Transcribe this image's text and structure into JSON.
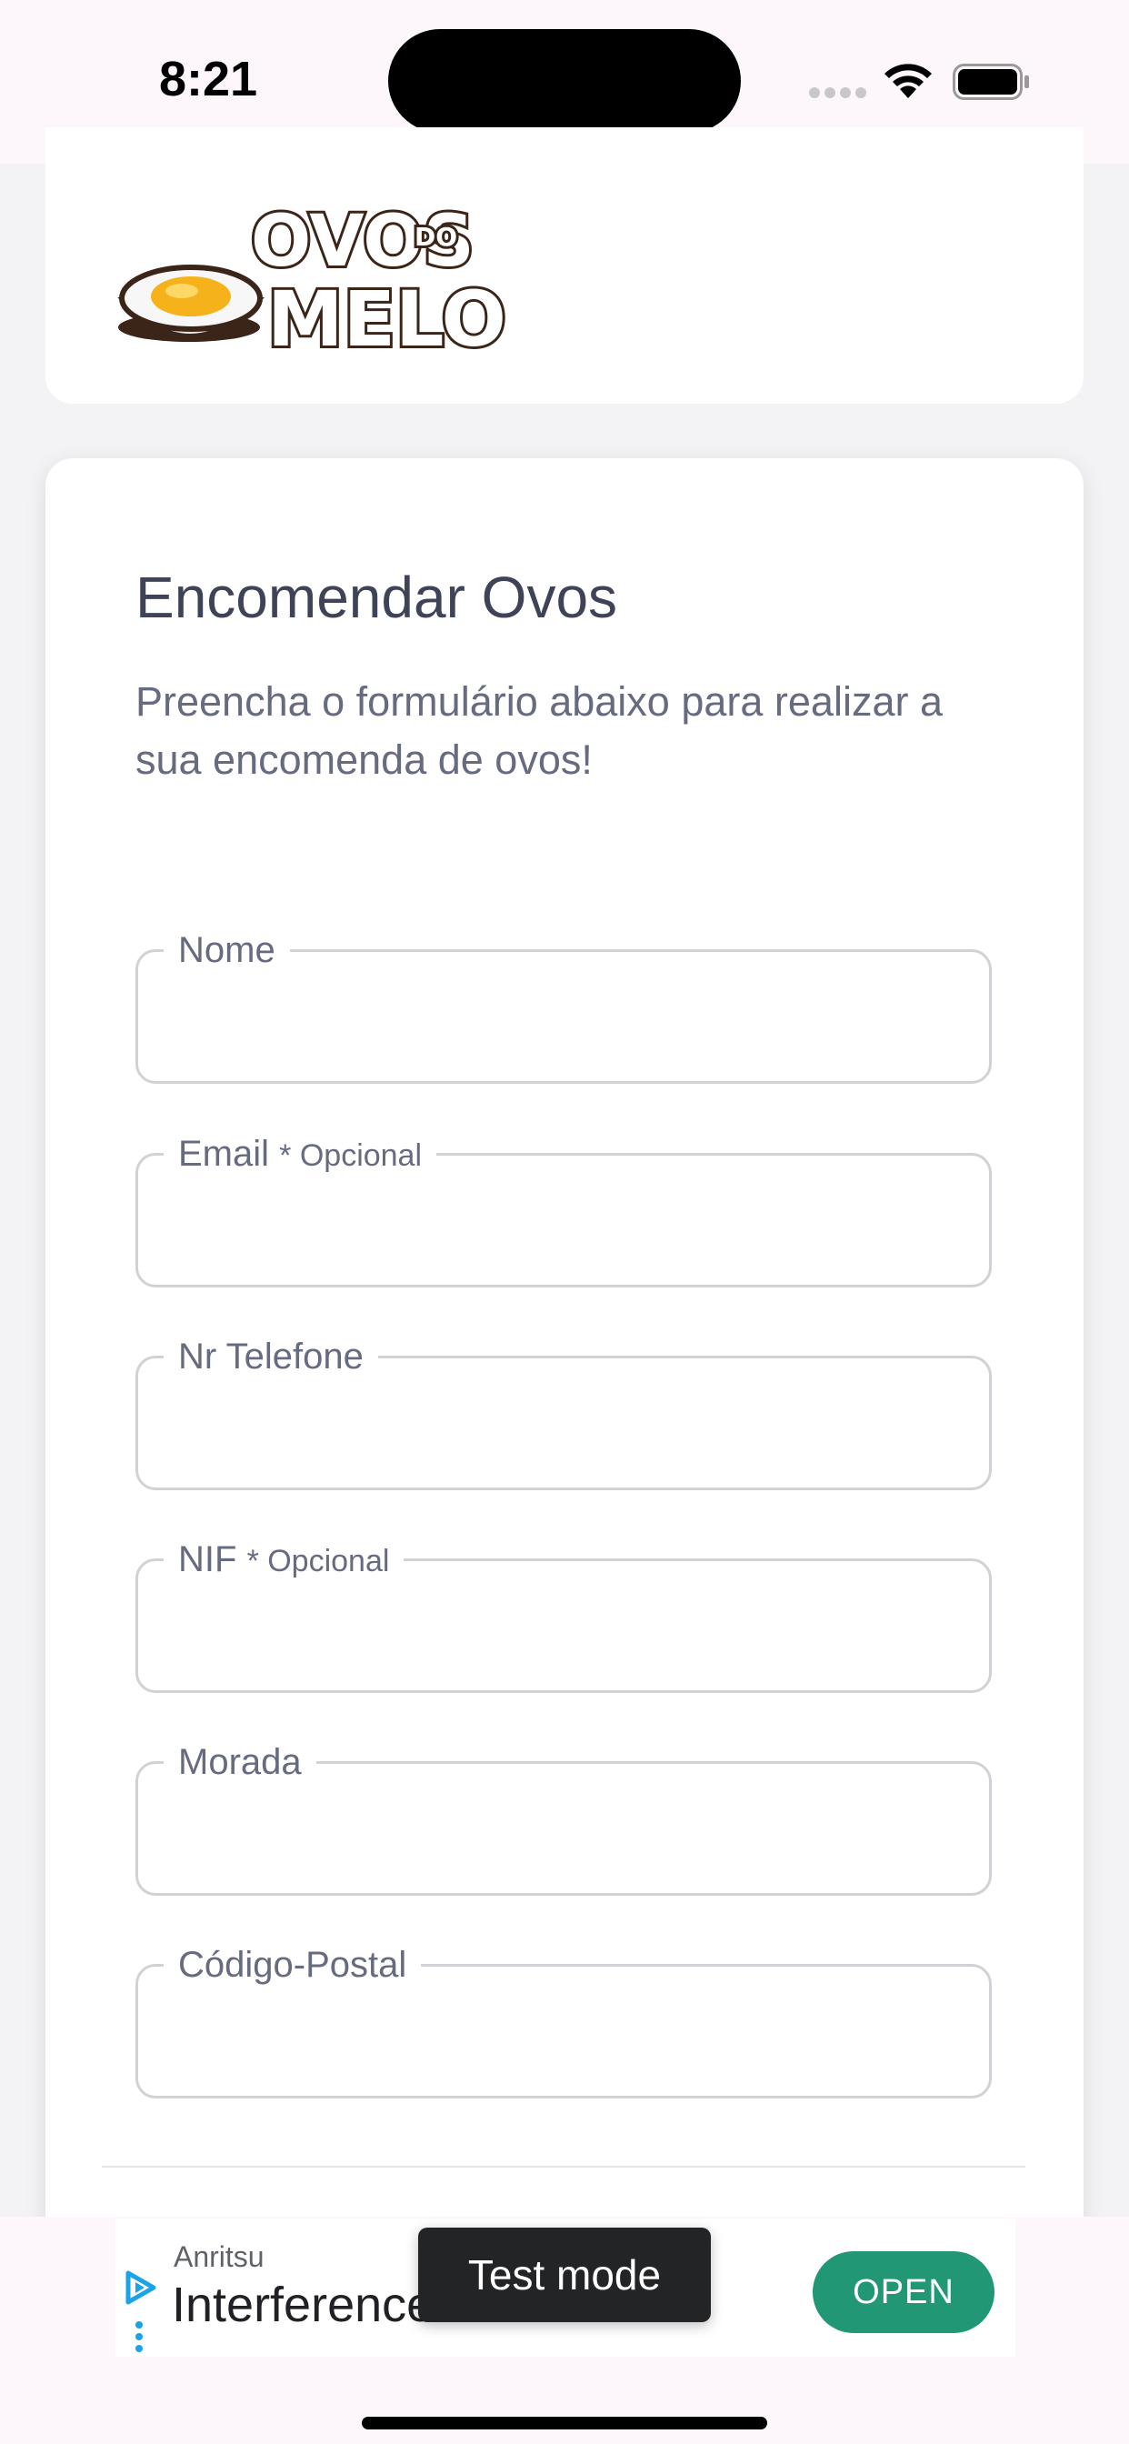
{
  "status_bar": {
    "time": "8:21",
    "icons": [
      "signal-dots-icon",
      "wifi-icon",
      "battery-icon"
    ]
  },
  "header": {
    "logo_line1": "OVOS",
    "logo_small": "DO",
    "logo_line2": "MELO"
  },
  "form": {
    "title": "Encomendar Ovos",
    "subtitle": "Preencha o formulário abaixo para realizar a sua encomenda de ovos!",
    "fields": [
      {
        "label": "Nome",
        "optional": "",
        "value": ""
      },
      {
        "label": "Email",
        "optional": "* Opcional",
        "value": ""
      },
      {
        "label": "Nr Telefone",
        "optional": "",
        "value": ""
      },
      {
        "label": "NIF",
        "optional": "* Opcional",
        "value": ""
      },
      {
        "label": "Morada",
        "optional": "",
        "value": ""
      },
      {
        "label": "Código-Postal",
        "optional": "",
        "value": ""
      }
    ]
  },
  "ad": {
    "sponsor": "Anritsu",
    "headline": "Interference Location",
    "cta": "OPEN",
    "test_mode": "Test mode",
    "cta_color": "#229775"
  }
}
